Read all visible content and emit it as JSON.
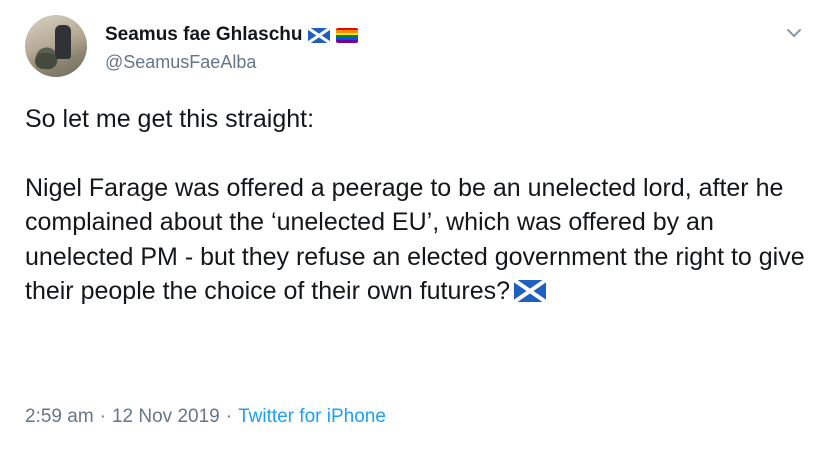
{
  "tweet": {
    "author_name": "Seamus fae Ghlaschu",
    "author_handle": "@SeamusFaeAlba",
    "name_flag_icon": "scotland-flag-icon",
    "name_pride_icon": "rainbow-flag-icon",
    "text_line1": "So let me get this straight:",
    "text_para2": "Nigel Farage was offered a peerage to be an unelected lord, after he complained about the ‘unelected EU’, which was offered by an unelected PM - but they refuse an elected government the right to give their people the choice of their own futures?",
    "time": "2:59 am",
    "separator": "·",
    "date": "12 Nov 2019",
    "source": "Twitter for iPhone"
  },
  "colors": {
    "text": "#14171a",
    "muted": "#657786",
    "link": "#1da1f2",
    "scotland_blue": "#1f5fbf"
  }
}
